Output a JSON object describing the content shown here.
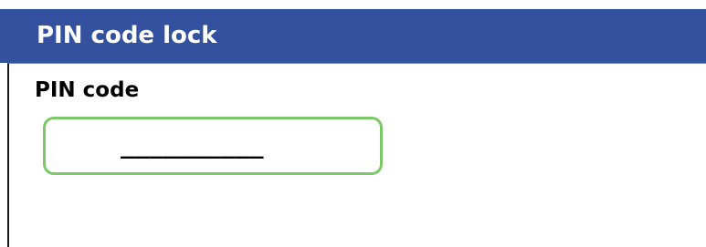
{
  "dialog": {
    "title": "PIN code lock"
  },
  "pin_field": {
    "label": "PIN code",
    "masked_value": "__________"
  },
  "colors": {
    "title_bar": "#34519f",
    "title_text": "#ffffff",
    "input_border": "#7bc866"
  }
}
